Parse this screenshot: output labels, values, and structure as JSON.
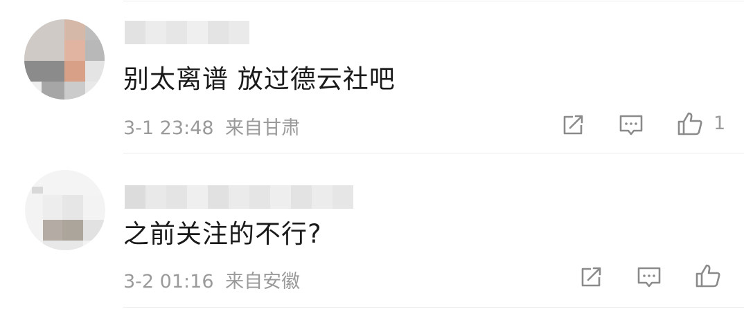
{
  "comments": [
    {
      "text": "别太离谱 放过德云社吧",
      "time": "3-1 23:48",
      "location": "来自甘肃",
      "likes": "1",
      "icons": [
        "share-icon",
        "comment-icon",
        "thumbs-up-icon"
      ]
    },
    {
      "text": "之前关注的不行?",
      "time": "3-2 01:16",
      "location": "来自安徽",
      "likes": "",
      "icons": [
        "share-icon",
        "comment-icon",
        "thumbs-up-icon"
      ]
    }
  ]
}
